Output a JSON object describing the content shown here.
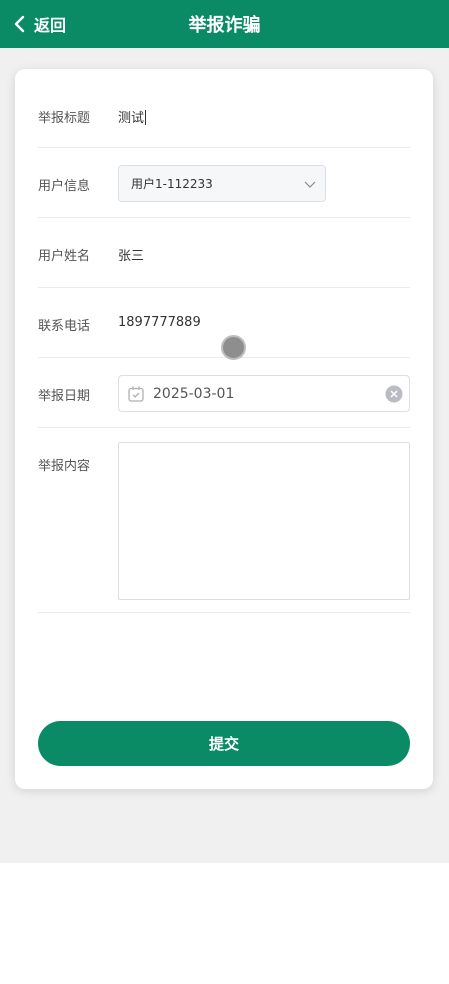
{
  "header": {
    "back_label": "返回",
    "title": "举报诈骗",
    "color": "#0a8a65"
  },
  "form": {
    "title_label": "举报标题",
    "title_value": "测试",
    "user_info_label": "用户信息",
    "user_info_selected": "用户1-112233",
    "user_name_label": "用户姓名",
    "user_name_value": "张三",
    "phone_label": "联系电话",
    "phone_value": "1897777889",
    "date_label": "举报日期",
    "date_value": "2025-03-01",
    "content_label": "举报内容",
    "content_value": ""
  },
  "submit_label": "提交",
  "icons": {
    "back": "chevron-left-icon",
    "select": "chevron-down-icon",
    "date": "calendar-icon",
    "clear": "clear-icon"
  }
}
